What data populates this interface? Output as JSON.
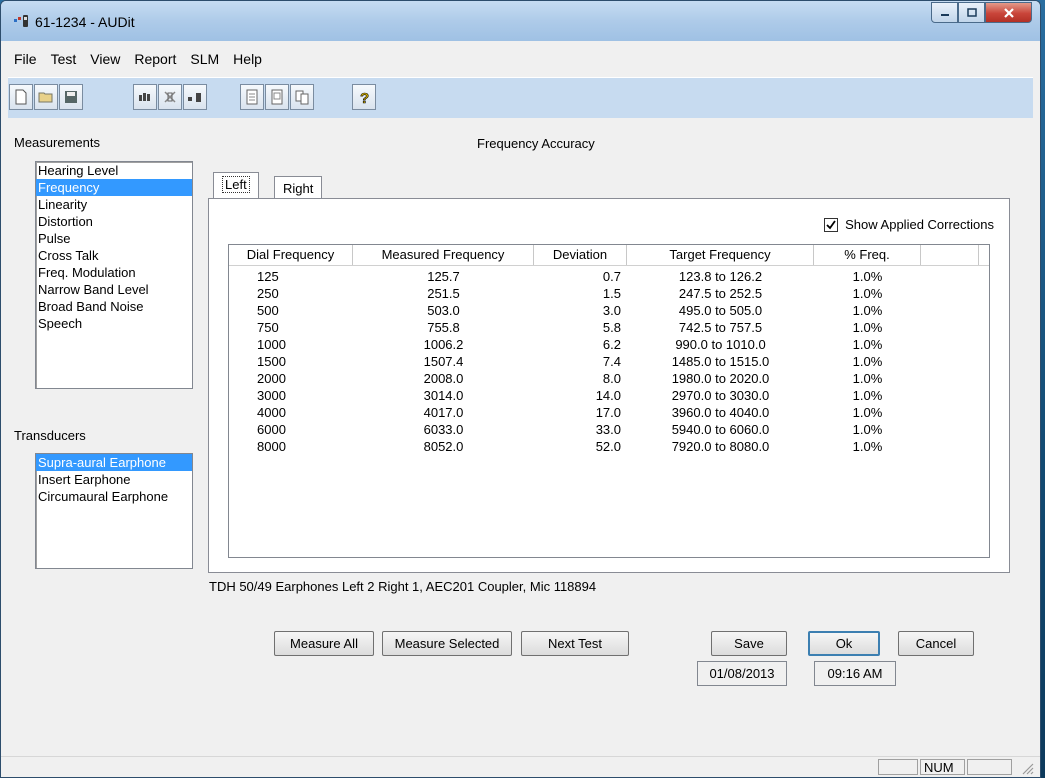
{
  "window": {
    "title": "61-1234 - AUDit",
    "icon": "audiometer-app-icon"
  },
  "menu": [
    "File",
    "Test",
    "View",
    "Report",
    "SLM",
    "Help"
  ],
  "toolbar": {
    "icons": [
      "new-document-icon",
      "open-folder-icon",
      "save-icon",
      "test-tone-icon",
      "transducer-icon",
      "meter-icon",
      "report-icon",
      "report-preview-icon",
      "report-print-icon",
      "help-icon"
    ]
  },
  "measurements": {
    "label": "Measurements",
    "items": [
      "Hearing Level",
      "Frequency",
      "Linearity",
      "Distortion",
      "Pulse",
      "Cross Talk",
      "Freq. Modulation",
      "Narrow Band Level",
      "Broad Band Noise",
      "Speech"
    ],
    "selected": "Frequency"
  },
  "transducers": {
    "label": "Transducers",
    "items": [
      "Supra-aural Earphone",
      "Insert Earphone",
      "Circumaural Earphone"
    ],
    "selected": "Supra-aural Earphone"
  },
  "panel": {
    "title": "Frequency Accuracy",
    "tabs": [
      "Left",
      "Right"
    ],
    "active_tab": "Left",
    "show_corrections_label": "Show Applied Corrections",
    "show_corrections_checked": true
  },
  "table": {
    "columns": [
      "Dial Frequency",
      "Measured Frequency",
      "Deviation",
      "Target Frequency",
      "% Freq."
    ],
    "rows": [
      [
        "125",
        "125.7",
        "0.7",
        "123.8 to 126.2",
        "1.0%"
      ],
      [
        "250",
        "251.5",
        "1.5",
        "247.5 to 252.5",
        "1.0%"
      ],
      [
        "500",
        "503.0",
        "3.0",
        "495.0 to 505.0",
        "1.0%"
      ],
      [
        "750",
        "755.8",
        "5.8",
        "742.5 to 757.5",
        "1.0%"
      ],
      [
        "1000",
        "1006.2",
        "6.2",
        "990.0 to 1010.0",
        "1.0%"
      ],
      [
        "1500",
        "1507.4",
        "7.4",
        "1485.0 to 1515.0",
        "1.0%"
      ],
      [
        "2000",
        "2008.0",
        "8.0",
        "1980.0 to 2020.0",
        "1.0%"
      ],
      [
        "3000",
        "3014.0",
        "14.0",
        "2970.0 to 3030.0",
        "1.0%"
      ],
      [
        "4000",
        "4017.0",
        "17.0",
        "3960.0 to 4040.0",
        "1.0%"
      ],
      [
        "6000",
        "6033.0",
        "33.0",
        "5940.0 to 6060.0",
        "1.0%"
      ],
      [
        "8000",
        "8052.0",
        "52.0",
        "7920.0 to 8080.0",
        "1.0%"
      ]
    ]
  },
  "equipment_line": "TDH 50/49 Earphones Left 2 Right 1, AEC201 Coupler, Mic 118894",
  "buttons": {
    "measure_all": "Measure All",
    "measure_selected": "Measure Selected",
    "next_test": "Next Test",
    "save": "Save",
    "ok": "Ok",
    "cancel": "Cancel"
  },
  "date": "01/08/2013",
  "time": "09:16 AM",
  "statusbar": {
    "num": "NUM"
  }
}
